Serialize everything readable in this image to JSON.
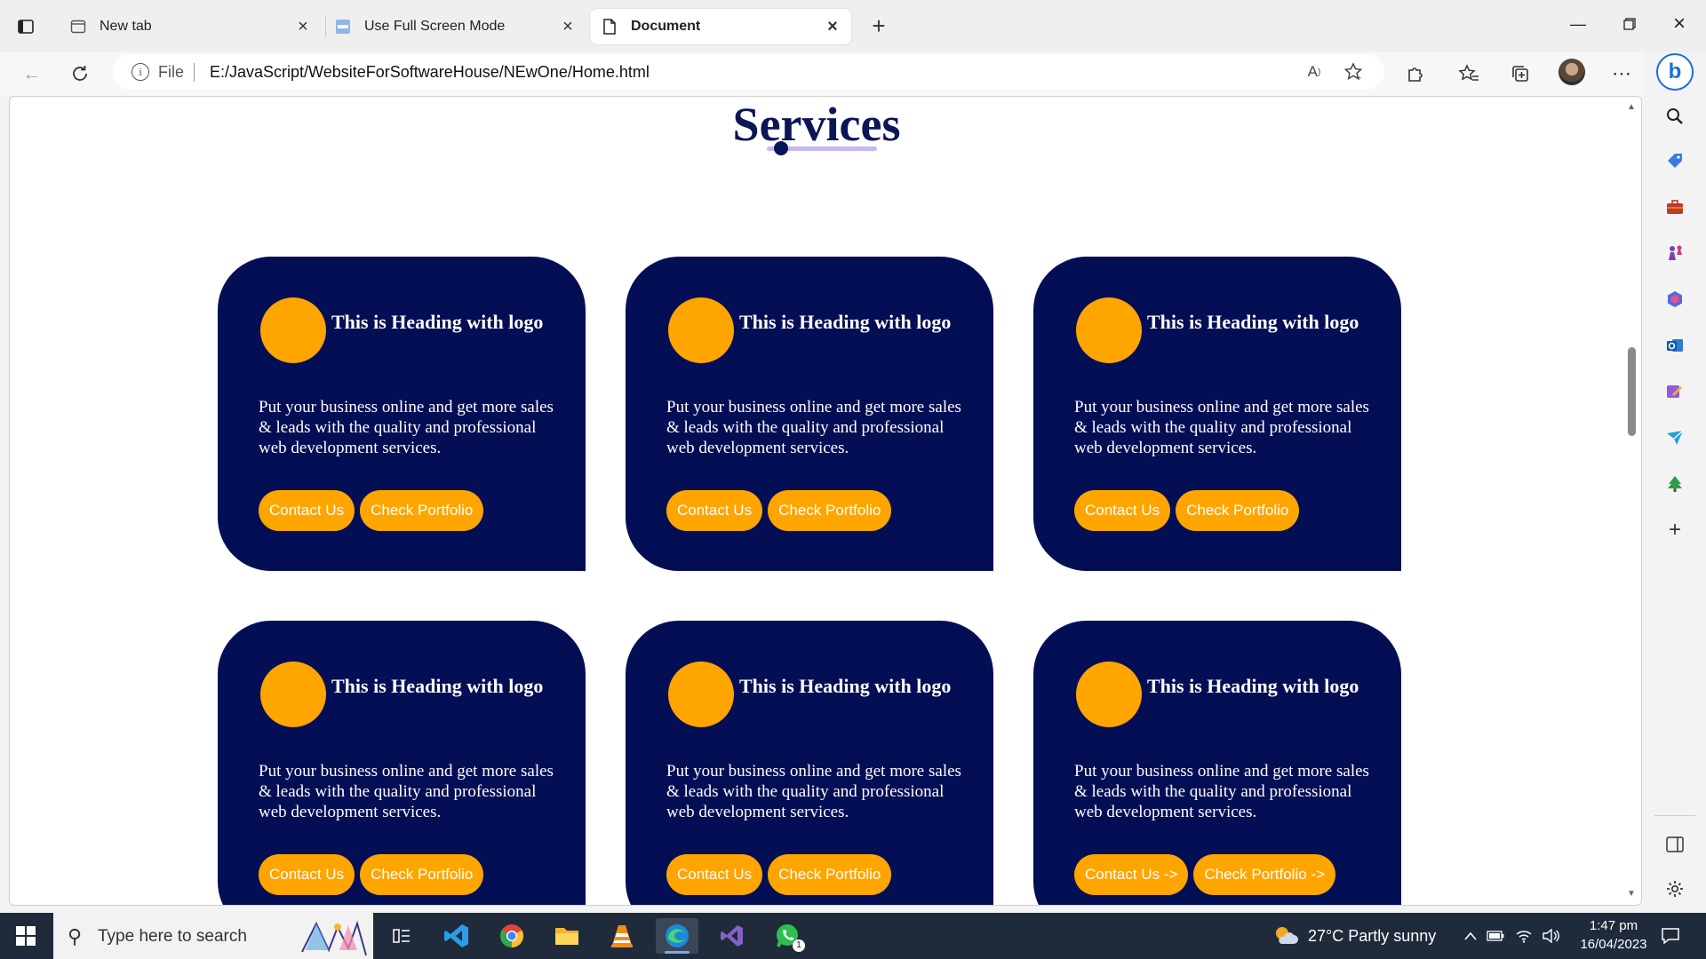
{
  "browser": {
    "tabs": [
      {
        "title": "New tab",
        "icon": "new-tab-page-icon",
        "active": false
      },
      {
        "title": "Use Full Screen Mode",
        "icon": "site-favicon-icon",
        "active": false
      },
      {
        "title": "Document",
        "icon": "document-icon",
        "active": true
      }
    ],
    "address": {
      "scheme_label": "File",
      "url": "E:/JavaScript/WebsiteForSoftwareHouse/NEwOne/Home.html"
    }
  },
  "page": {
    "section_title": "Services",
    "cards": [
      {
        "heading": "This is Heading with logo",
        "description": "Put your business online and get more sales & leads with the quality and professional web development services.",
        "primary_button": "Contact Us",
        "secondary_button": "Check Portfolio"
      },
      {
        "heading": "This is Heading with logo",
        "description": "Put your business online and get more sales & leads with the quality and professional web development services.",
        "primary_button": "Contact Us",
        "secondary_button": "Check Portfolio"
      },
      {
        "heading": "This is Heading with logo",
        "description": "Put your business online and get more sales & leads with the quality and professional web development services.",
        "primary_button": "Contact Us",
        "secondary_button": "Check Portfolio"
      },
      {
        "heading": "This is Heading with logo",
        "description": "Put your business online and get more sales & leads with the quality and professional web development services.",
        "primary_button": "Contact Us",
        "secondary_button": "Check Portfolio"
      },
      {
        "heading": "This is Heading with logo",
        "description": "Put your business online and get more sales & leads with the quality and professional web development services.",
        "primary_button": "Contact Us",
        "secondary_button": "Check Portfolio"
      },
      {
        "heading": "This is Heading with logo",
        "description": "Put your business online and get more sales & leads with the quality and professional web development services.",
        "primary_button": "Contact Us ->",
        "secondary_button": "Check Portfolio ->"
      }
    ],
    "colors": {
      "card_bg": "#040e55",
      "accent": "#ffa500",
      "title": "#0b1657",
      "title_line": "#c8b8ef"
    }
  },
  "taskbar": {
    "search_placeholder": "Type here to search",
    "apps": [
      "task-view-icon",
      "vscode-icon",
      "chrome-icon",
      "file-explorer-icon",
      "vlc-icon",
      "edge-icon",
      "visual-studio-icon",
      "whatsapp-icon"
    ],
    "whatsapp_badge": "1",
    "weather": "27°C  Partly sunny",
    "time": "1:47 pm",
    "date": "16/04/2023"
  }
}
